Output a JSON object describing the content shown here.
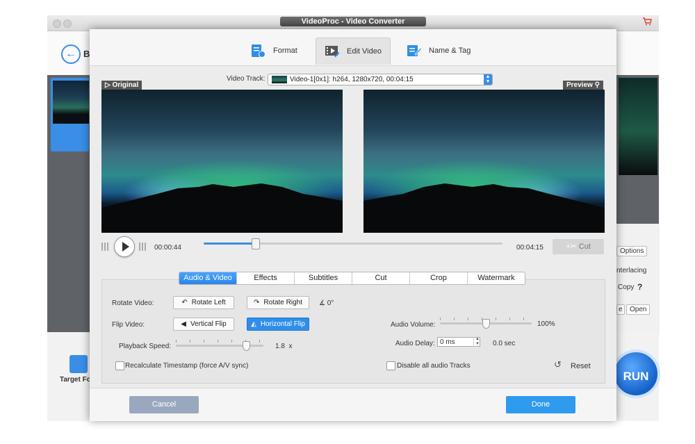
{
  "app": {
    "title": "VideoProc - Video Converter",
    "back_label": "B",
    "target_label": "Target For",
    "run_label": "RUN"
  },
  "bg_right": {
    "options": "Options",
    "interlacing": "nterlacing",
    "copy": "Copy",
    "help": "?",
    "open_label": "Open",
    "e_label": "e"
  },
  "dialog": {
    "tabs": [
      {
        "label": "Format",
        "icon": "format-icon"
      },
      {
        "label": "Edit Video",
        "icon": "film-edit-icon",
        "active": true
      },
      {
        "label": "Name & Tag",
        "icon": "tag-edit-icon"
      }
    ],
    "video_track": {
      "label": "Video Track:",
      "value": "Video-1[0x1]: h264, 1280x720, 00:04:15"
    },
    "original_label": "Original",
    "preview_label": "Preview",
    "playback": {
      "current_time": "00:00:44",
      "total_time": "00:04:15",
      "progress": 0.173,
      "cut_label": "Cut"
    },
    "subtabs": [
      "Audio & Video",
      "Effects",
      "Subtitles",
      "Cut",
      "Crop",
      "Watermark"
    ],
    "active_subtab": 0,
    "rotate": {
      "label": "Rotate Video:",
      "left": "Rotate Left",
      "right": "Rotate Right",
      "angle": "0°"
    },
    "flip": {
      "label": "Flip Video:",
      "vertical": "Vertical Flip",
      "horizontal": "Horizontal Flip"
    },
    "speed": {
      "label": "Playback Speed:",
      "value": "1.8",
      "unit": "x",
      "level": 0.8
    },
    "recalc": {
      "label": "Recalculate Timestamp (force A/V sync)",
      "checked": false
    },
    "volume": {
      "label": "Audio Volume:",
      "value": "100%",
      "level": 0.5
    },
    "delay": {
      "label": "Audio Delay:",
      "input": "0 ms",
      "value": "0.0 sec"
    },
    "disable_audio": {
      "label": "Disable all audio Tracks",
      "checked": false
    },
    "reset_label": "Reset",
    "cancel_label": "Cancel",
    "done_label": "Done"
  },
  "colors": {
    "accent": "#2f8ee8",
    "cancel": "#9aa8bf",
    "cart": "#e23b2f"
  }
}
